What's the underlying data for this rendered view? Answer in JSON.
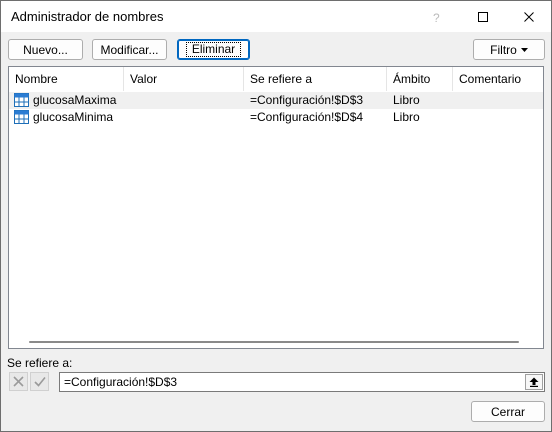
{
  "window": {
    "title": "Administrador de nombres"
  },
  "toolbar": {
    "new_label": "Nuevo...",
    "edit_label": "Modificar...",
    "delete_label": "Eliminar",
    "filter_label": "Filtro"
  },
  "table": {
    "columns": [
      "Nombre",
      "Valor",
      "Se refiere a",
      "Ámbito",
      "Comentario"
    ],
    "rows": [
      {
        "name": "glucosaMaxima",
        "value": "",
        "refers_to": "=Configuración!$D$3",
        "scope": "Libro",
        "comment": ""
      },
      {
        "name": "glucosaMinima",
        "value": "",
        "refers_to": "=Configuración!$D$4",
        "scope": "Libro",
        "comment": ""
      }
    ]
  },
  "refers": {
    "label": "Se refiere a:",
    "value": "=Configuración!$D$3"
  },
  "footer": {
    "close_label": "Cerrar"
  },
  "icons": {
    "help": "help-icon",
    "maximize": "maximize-icon",
    "close": "close-icon",
    "filter_dropdown": "chevron-down-icon",
    "name_range": "table-range-icon",
    "cancel": "cancel-x-icon",
    "confirm": "checkmark-icon",
    "collapse": "collapse-dialog-icon"
  }
}
